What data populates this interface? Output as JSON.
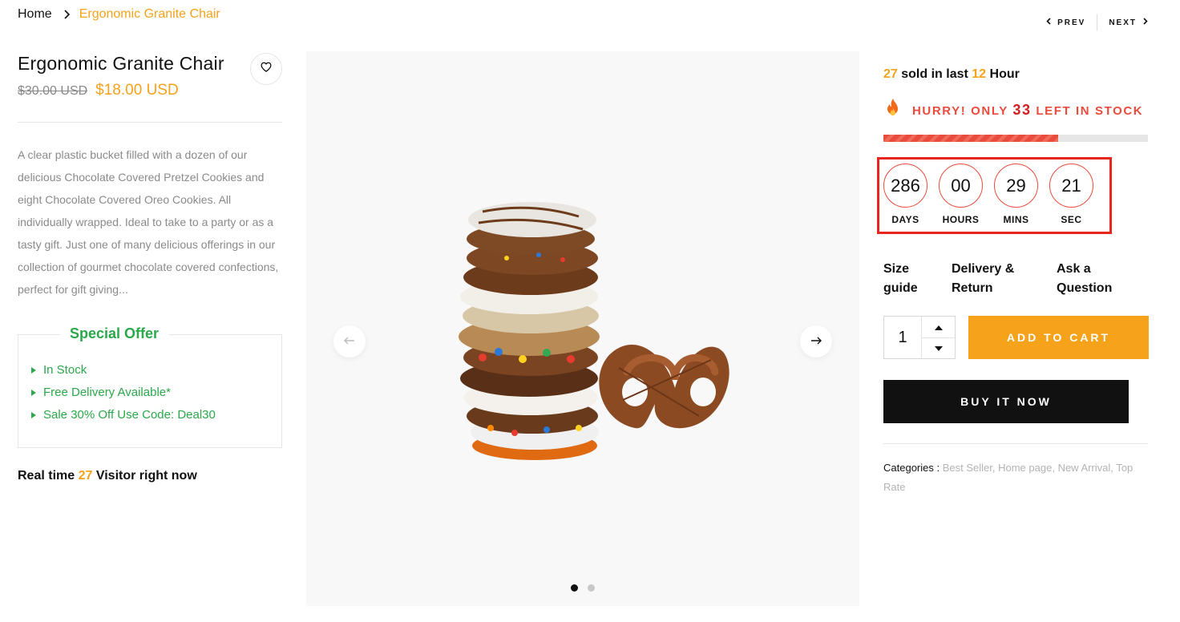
{
  "breadcrumb": {
    "home": "Home",
    "current": "Ergonomic Granite Chair"
  },
  "pager": {
    "prev": "PREV",
    "next": "NEXT"
  },
  "product": {
    "title": "Ergonomic Granite Chair",
    "old_price": "$30.00 USD",
    "price": "$18.00 USD",
    "description": "A clear plastic bucket filled with a dozen of our delicious Chocolate Covered Pretzel Cookies and eight Chocolate Covered Oreo Cookies. All individually wrapped. Ideal to take to a party or as a tasty gift. Just one of many delicious offerings in our collection of gourmet chocolate covered confections, perfect for gift giving..."
  },
  "offer": {
    "title": "Special Offer",
    "items": [
      "In Stock",
      "Free Delivery Available*",
      "Sale 30% Off Use Code: Deal30"
    ]
  },
  "visitors": {
    "prefix": "Real time",
    "count": "27",
    "suffix": "Visitor right now"
  },
  "sold": {
    "count": "27",
    "middle": "sold in last",
    "hours": "12",
    "suffix": "Hour"
  },
  "stock": {
    "prefix": "HURRY! ONLY",
    "count": "33",
    "suffix": "LEFT IN STOCK",
    "fill_fraction": 0.66
  },
  "countdown": [
    {
      "value": "286",
      "label": "DAYS"
    },
    {
      "value": "00",
      "label": "HOURS"
    },
    {
      "value": "29",
      "label": "MINS"
    },
    {
      "value": "21",
      "label": "SEC"
    }
  ],
  "links": {
    "size_line1": "Size",
    "size_line2": "guide",
    "delivery_line1": "Delivery &",
    "delivery_line2": "Return",
    "ask_line1": "Ask a",
    "ask_line2": "Question"
  },
  "cart": {
    "quantity": "1",
    "add_to_cart": "ADD TO CART",
    "buy_now": "BUY IT NOW"
  },
  "categories": {
    "label": "Categories :",
    "items": [
      "Best Seller,",
      "Home page,",
      "New Arrival,",
      "Top Rate"
    ]
  },
  "gallery": {
    "slides": 2,
    "active_slide": 1
  },
  "icons": {
    "wishlist": "heart-icon",
    "stock": "fire-icon",
    "prev": "arrow-left-icon",
    "next": "arrow-right-icon"
  },
  "colors": {
    "accent": "#f7a21b",
    "stock_red": "#e94b3c",
    "offer_green": "#2aa84a",
    "highlight": "#e8261d"
  }
}
